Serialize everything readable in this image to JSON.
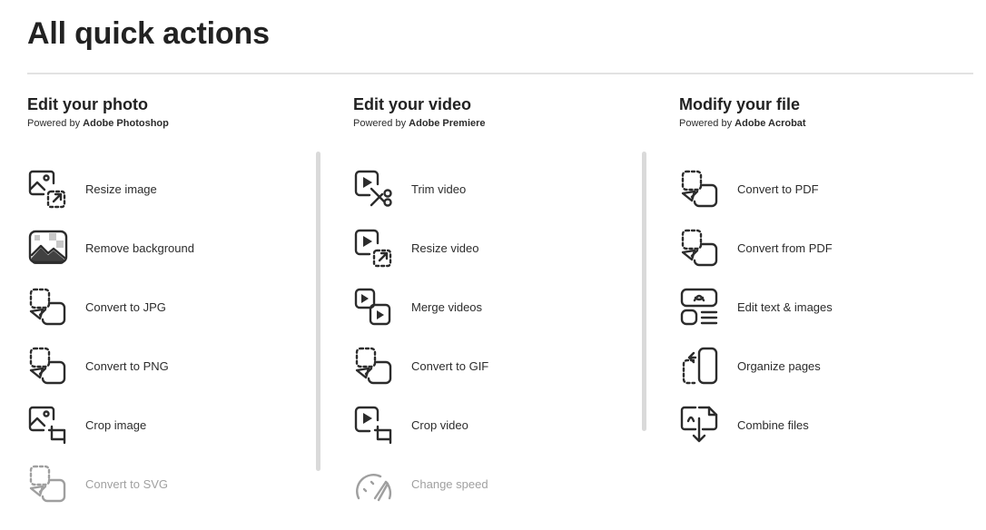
{
  "page": {
    "title": "All quick actions"
  },
  "columns": [
    {
      "heading": "Edit your photo",
      "powered_prefix": "Powered by",
      "powered_product": "Adobe Photoshop",
      "items": [
        {
          "label": "Resize image",
          "icon": "resize-image-icon"
        },
        {
          "label": "Remove background",
          "icon": "remove-background-icon"
        },
        {
          "label": "Convert to JPG",
          "icon": "convert-icon"
        },
        {
          "label": "Convert to PNG",
          "icon": "convert-icon"
        },
        {
          "label": "Crop image",
          "icon": "crop-image-icon"
        },
        {
          "label": "Convert to SVG",
          "icon": "convert-icon"
        }
      ]
    },
    {
      "heading": "Edit your video",
      "powered_prefix": "Powered by",
      "powered_product": "Adobe Premiere",
      "items": [
        {
          "label": "Trim video",
          "icon": "trim-video-icon"
        },
        {
          "label": "Resize video",
          "icon": "resize-video-icon"
        },
        {
          "label": "Merge videos",
          "icon": "merge-videos-icon"
        },
        {
          "label": "Convert to GIF",
          "icon": "convert-icon"
        },
        {
          "label": "Crop video",
          "icon": "crop-video-icon"
        },
        {
          "label": "Change speed",
          "icon": "speed-gauge-icon"
        }
      ]
    },
    {
      "heading": "Modify your file",
      "powered_prefix": "Powered by",
      "powered_product": "Adobe Acrobat",
      "items": [
        {
          "label": "Convert to PDF",
          "icon": "convert-icon"
        },
        {
          "label": "Convert from PDF",
          "icon": "convert-icon"
        },
        {
          "label": "Edit text & images",
          "icon": "edit-pdf-icon"
        },
        {
          "label": "Organize pages",
          "icon": "organize-pages-icon"
        },
        {
          "label": "Combine files",
          "icon": "combine-files-icon"
        }
      ]
    }
  ],
  "colors": {
    "text": "#2c2c2c",
    "divider": "#e2e2e2",
    "scrollbar": "#dadada"
  }
}
